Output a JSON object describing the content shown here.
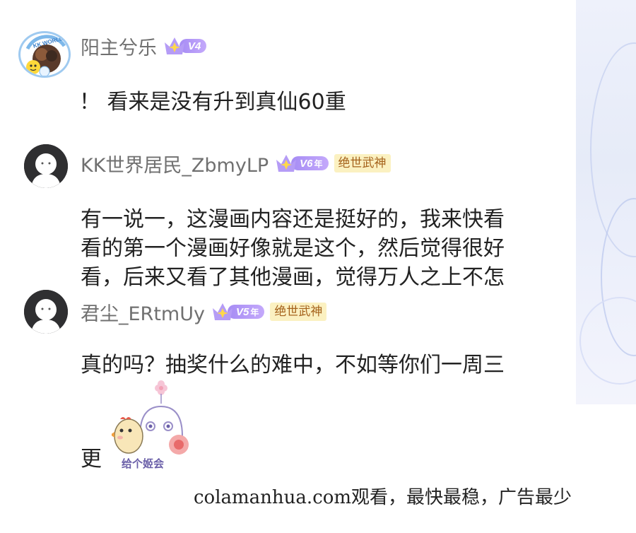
{
  "comments": [
    {
      "username": "阳主兮乐",
      "vip_level": "V4",
      "vip_year": "",
      "title_badge": "",
      "text": "！ 看来是没有升到真仙60重"
    },
    {
      "username": "KK世界居民_ZbmyLP",
      "vip_level": "V6",
      "vip_year": "年",
      "title_badge": "绝世武神",
      "text_lines": [
        "有一说一，这漫画内容还是挺好的，我来快看",
        "看的第一个漫画好像就是这个，然后觉得很好",
        "看，后来又看了其他漫画，觉得万人之上不怎"
      ]
    },
    {
      "username": "君尘_ERtmUy",
      "vip_level": "V5",
      "vip_year": "年",
      "title_badge": "绝世武神",
      "text": "真的吗？抽奖什么的难中，不如等你们一周三",
      "text_tail": "更",
      "sticker_caption": "给个姬会"
    }
  ],
  "avatar_badge_text": "KK WORLD",
  "footer": "colamanhua.com观看，最快最稳，广告最少",
  "colors": {
    "vip_gradient_start": "#a68cf4",
    "vip_gradient_end": "#c4a9fb",
    "title_badge_bg": "#fbf1c1",
    "title_badge_text": "#a5621b",
    "username": "#707070"
  },
  "icons": [
    "crown-icon",
    "default-avatar-icon",
    "kk-world-avatar-icon",
    "chick-sticker-icon"
  ]
}
